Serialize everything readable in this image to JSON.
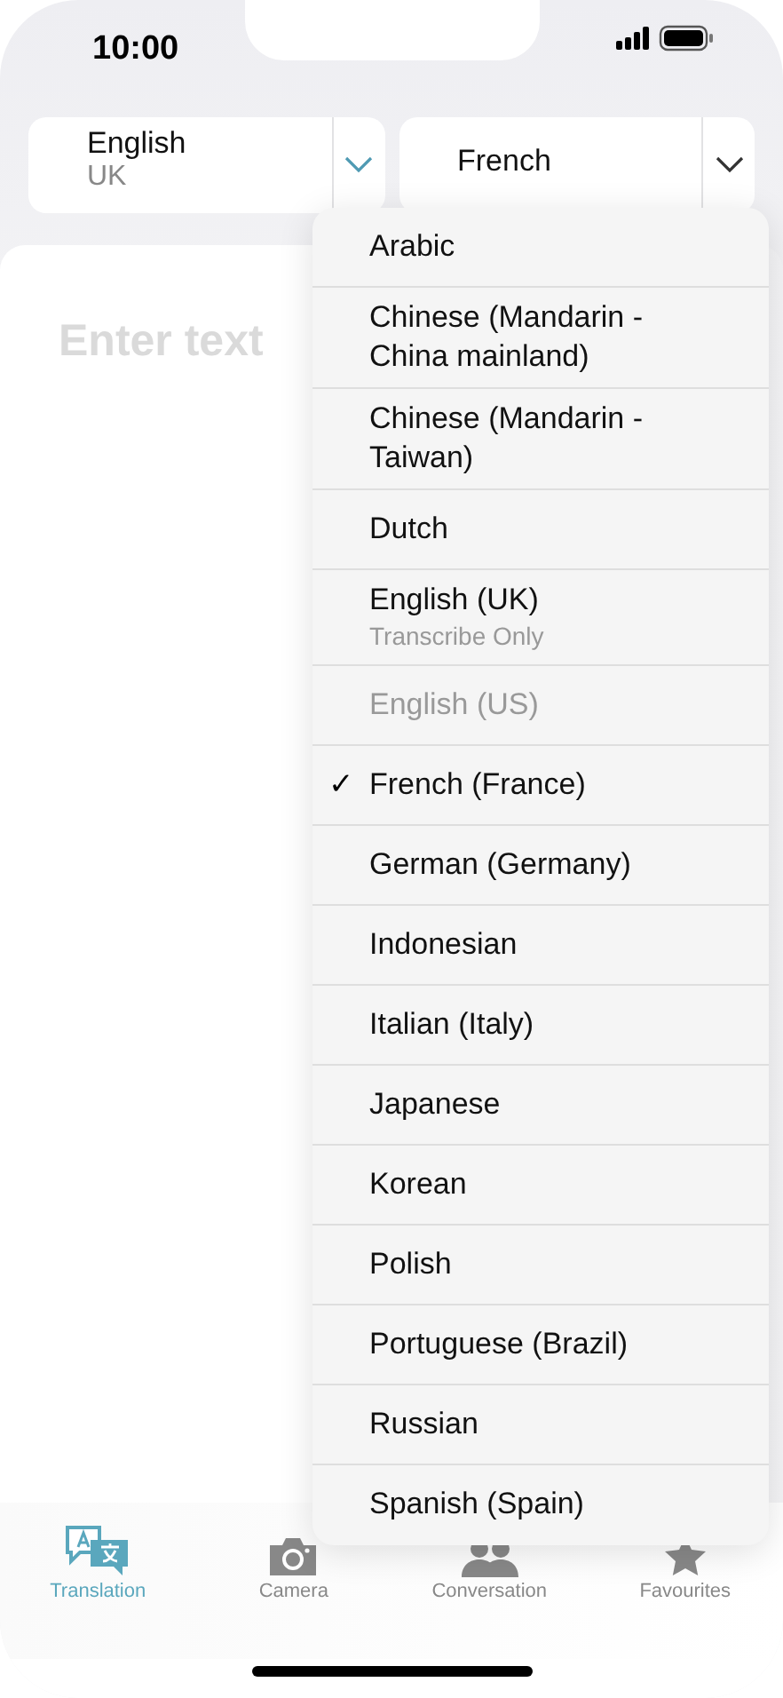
{
  "status_bar": {
    "time": "10:00"
  },
  "source_language": {
    "name": "English",
    "region": "UK"
  },
  "target_language": {
    "name": "French"
  },
  "input": {
    "placeholder": "Enter text"
  },
  "language_menu": [
    {
      "label": "Arabic",
      "checked": false,
      "disabled": false
    },
    {
      "label": "Chinese (Mandarin - China mainland)",
      "checked": false,
      "disabled": false
    },
    {
      "label": "Chinese (Mandarin - Taiwan)",
      "checked": false,
      "disabled": false
    },
    {
      "label": "Dutch",
      "checked": false,
      "disabled": false
    },
    {
      "label": "English (UK)",
      "sublabel": "Transcribe Only",
      "checked": false,
      "disabled": false
    },
    {
      "label": "English (US)",
      "checked": false,
      "disabled": true
    },
    {
      "label": "French (France)",
      "checked": true,
      "disabled": false
    },
    {
      "label": "German (Germany)",
      "checked": false,
      "disabled": false
    },
    {
      "label": "Indonesian",
      "checked": false,
      "disabled": false
    },
    {
      "label": "Italian (Italy)",
      "checked": false,
      "disabled": false
    },
    {
      "label": "Japanese",
      "checked": false,
      "disabled": false
    },
    {
      "label": "Korean",
      "checked": false,
      "disabled": false
    },
    {
      "label": "Polish",
      "checked": false,
      "disabled": false
    },
    {
      "label": "Portuguese (Brazil)",
      "checked": false,
      "disabled": false
    },
    {
      "label": "Russian",
      "checked": false,
      "disabled": false
    },
    {
      "label": "Spanish (Spain)",
      "checked": false,
      "disabled": false
    }
  ],
  "check_mark": "✓",
  "tabs": [
    {
      "kind": "translation",
      "label": "Translation",
      "selected": true
    },
    {
      "kind": "camera",
      "label": "Camera",
      "selected": false
    },
    {
      "kind": "conversation",
      "label": "Conversation",
      "selected": false
    },
    {
      "kind": "favourites",
      "label": "Favourites",
      "selected": false
    }
  ]
}
